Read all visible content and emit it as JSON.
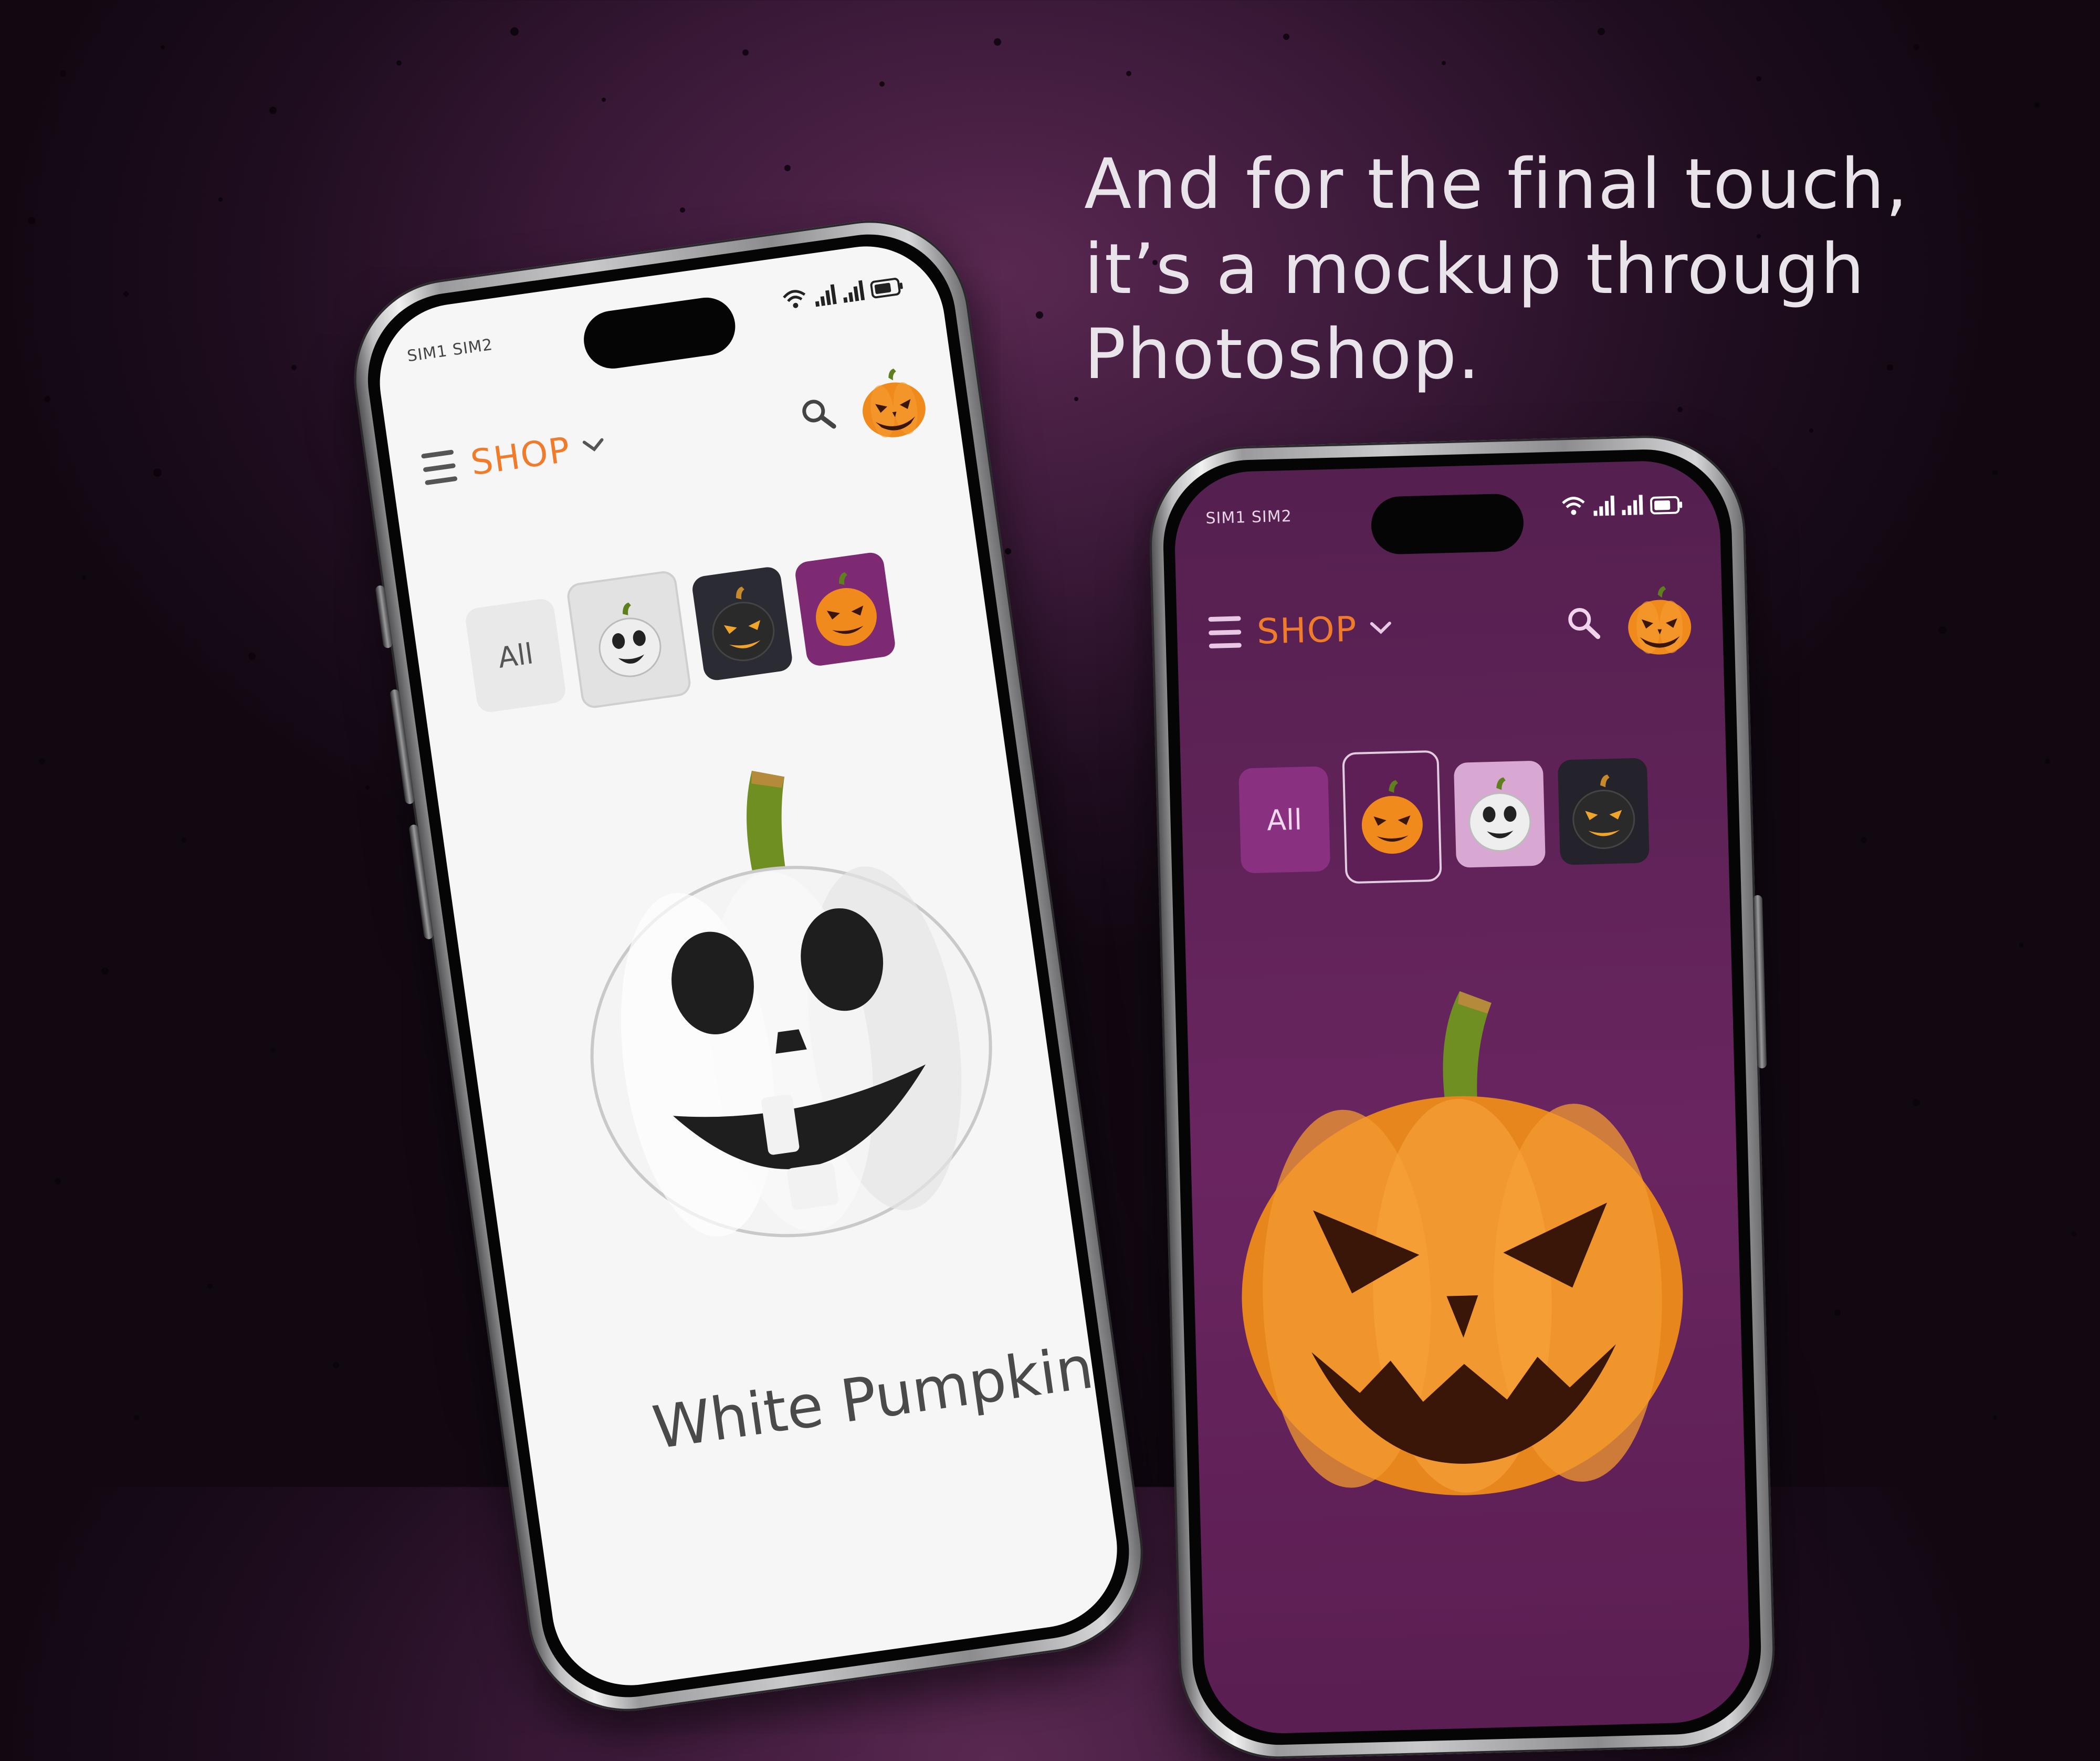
{
  "headline": {
    "line1": "And for the final touch,",
    "line2": "it’s a mockup through",
    "line3": "Photoshop."
  },
  "status_bar": {
    "sim_text": "SIM1 SIM2"
  },
  "app_bar": {
    "title": "SHOP",
    "dropdown_icon": "chevron-down-icon",
    "search_icon": "search-icon",
    "avatar_icon": "jack-o-lantern-icon"
  },
  "left_phone": {
    "theme": "light",
    "categories": [
      {
        "label": "All",
        "kind": "text"
      },
      {
        "icon": "white-pumpkin-icon",
        "selected": true
      },
      {
        "icon": "black-pumpkin-icon"
      },
      {
        "icon": "orange-pumpkin-icon"
      }
    ],
    "product_name": "White Pumpkin"
  },
  "right_phone": {
    "theme": "dark",
    "categories": [
      {
        "label": "All",
        "kind": "text"
      },
      {
        "icon": "orange-pumpkin-icon",
        "selected": true
      },
      {
        "icon": "white-pumpkin-icon"
      },
      {
        "icon": "black-pumpkin-icon"
      }
    ]
  },
  "colors": {
    "accent_orange": "#f07b2b",
    "background_purple": "#3c1a3a",
    "dark_screen_purple": "#6a2560",
    "light_screen": "#f6f6f6"
  }
}
